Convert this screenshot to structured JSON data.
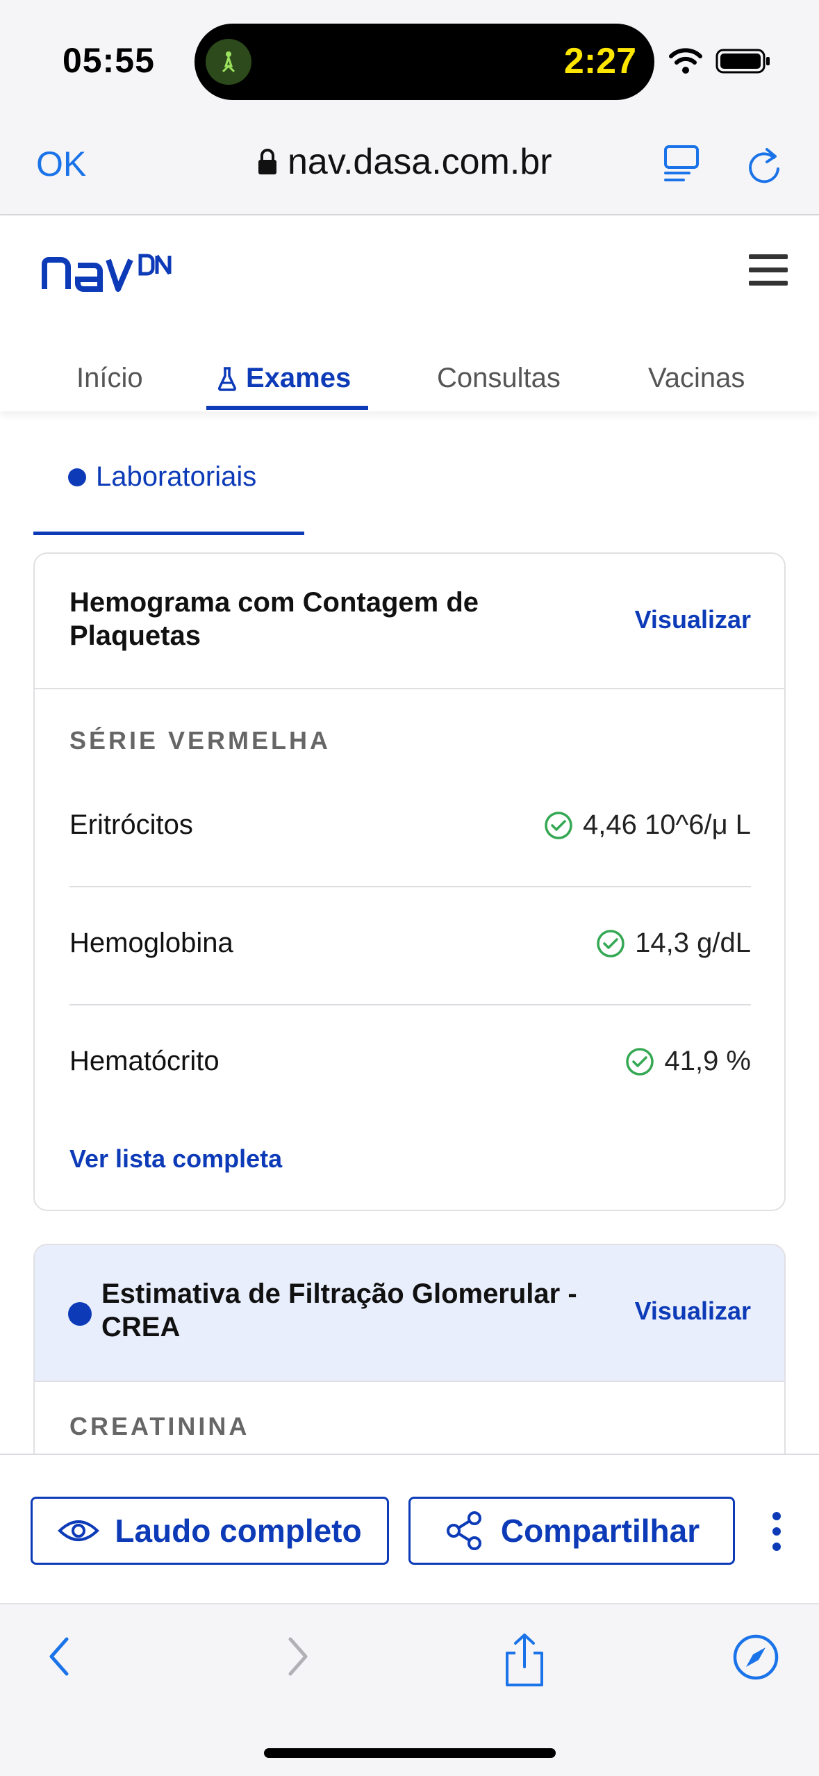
{
  "status_bar": {
    "time": "05:55",
    "activity_timer": "2:27"
  },
  "browser": {
    "done_label": "OK",
    "url": "nav.dasa.com.br"
  },
  "site": {
    "tabs": [
      {
        "label": "Início",
        "active": false
      },
      {
        "label": "Exames",
        "active": true
      },
      {
        "label": "Consultas",
        "active": false
      },
      {
        "label": "Vacinas",
        "active": false
      }
    ],
    "sub_tab": "Laboratoriais"
  },
  "exams": [
    {
      "title": "Hemograma com Contagem de Plaquetas",
      "view_label": "Visualizar",
      "section": "SÉRIE VERMELHA",
      "rows": [
        {
          "name": "Eritrócitos",
          "value": "4,46 10^6/μ L",
          "status": "normal"
        },
        {
          "name": "Hemoglobina",
          "value": "14,3 g/dL",
          "status": "normal"
        },
        {
          "name": "Hematócrito",
          "value": "41,9 %",
          "status": "normal"
        }
      ],
      "more_label": "Ver lista completa"
    },
    {
      "title": "Estimativa de Filtração Glomerular - CREA",
      "view_label": "Visualizar",
      "section": "CREATININA"
    }
  ],
  "actions": {
    "full_report": "Laudo completo",
    "share": "Compartilhar"
  },
  "colors": {
    "brand": "#0d3bb8",
    "ios_blue": "#1a73e8",
    "ok_green": "#34a853",
    "highlight_bg": "#e9eefc"
  }
}
